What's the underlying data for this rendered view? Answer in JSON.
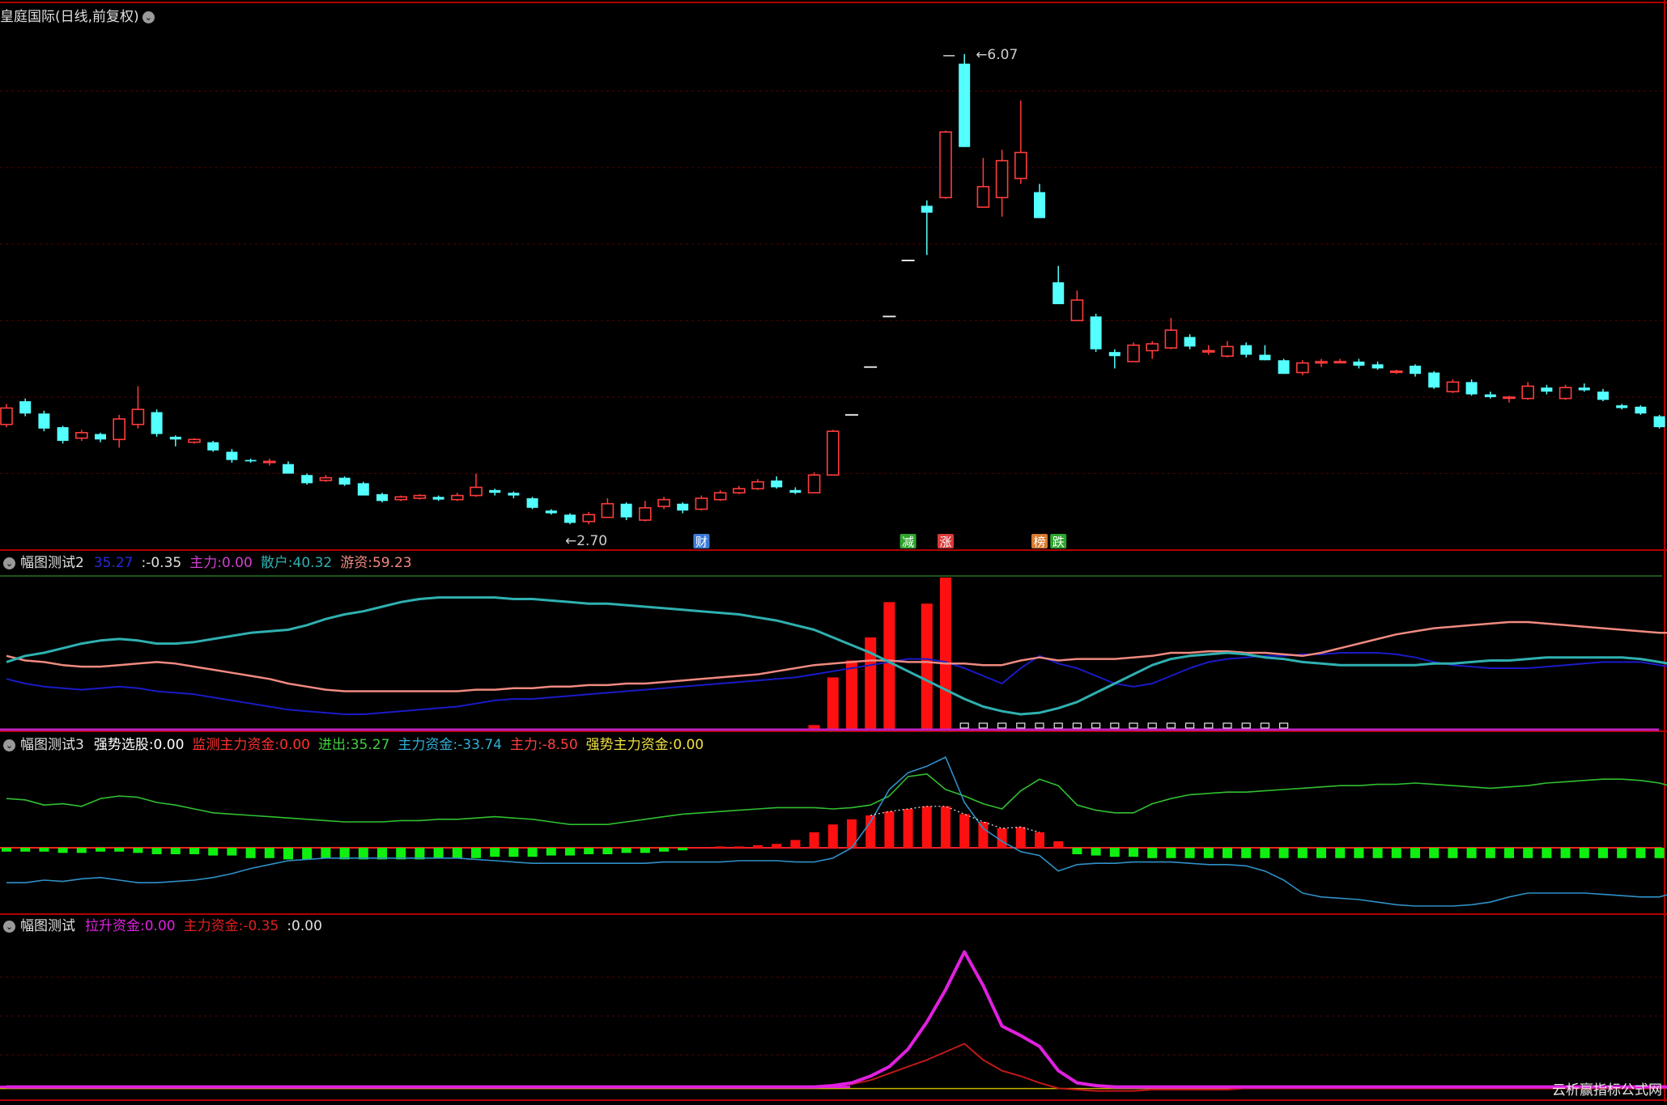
{
  "main": {
    "title": "皇庭国际(日线,前复权)",
    "high_label": "6.07",
    "low_label": "2.70",
    "ylim": [
      2.5,
      6.3
    ],
    "markers": [
      {
        "idx": 37,
        "text": "财",
        "color": "#3d7bd8"
      },
      {
        "idx": 48,
        "text": "减",
        "color": "#2fa52f"
      },
      {
        "idx": 50,
        "text": "涨",
        "color": "#d83a3a"
      },
      {
        "idx": 55,
        "text": "榜",
        "color": "#d87a2f"
      },
      {
        "idx": 56,
        "text": "跌",
        "color": "#2fa52f"
      }
    ]
  },
  "candles": [
    [
      3.36,
      3.48,
      3.51,
      3.34
    ],
    [
      3.53,
      3.44,
      3.55,
      3.42
    ],
    [
      3.44,
      3.33,
      3.46,
      3.31
    ],
    [
      3.34,
      3.24,
      3.35,
      3.22
    ],
    [
      3.26,
      3.3,
      3.32,
      3.24
    ],
    [
      3.29,
      3.25,
      3.3,
      3.23
    ],
    [
      3.25,
      3.4,
      3.43,
      3.19
    ],
    [
      3.36,
      3.47,
      3.64,
      3.33
    ],
    [
      3.45,
      3.29,
      3.47,
      3.27
    ],
    [
      3.27,
      3.25,
      3.28,
      3.2
    ],
    [
      3.23,
      3.25,
      3.26,
      3.22
    ],
    [
      3.23,
      3.17,
      3.24,
      3.16
    ],
    [
      3.16,
      3.1,
      3.18,
      3.08
    ],
    [
      3.1,
      3.09,
      3.11,
      3.08
    ],
    [
      3.09,
      3.09,
      3.11,
      3.06
    ],
    [
      3.07,
      3.0,
      3.09,
      3.0
    ],
    [
      2.99,
      2.93,
      3.0,
      2.92
    ],
    [
      2.95,
      2.97,
      2.99,
      2.94
    ],
    [
      2.97,
      2.92,
      2.98,
      2.91
    ],
    [
      2.93,
      2.84,
      2.94,
      2.84
    ],
    [
      2.85,
      2.8,
      2.86,
      2.79
    ],
    [
      2.81,
      2.83,
      2.84,
      2.8
    ],
    [
      2.82,
      2.84,
      2.85,
      2.81
    ],
    [
      2.83,
      2.81,
      2.84,
      2.8
    ],
    [
      2.81,
      2.84,
      2.86,
      2.8
    ],
    [
      2.84,
      2.9,
      3.0,
      2.83
    ],
    [
      2.88,
      2.86,
      2.89,
      2.84
    ],
    [
      2.86,
      2.84,
      2.87,
      2.82
    ],
    [
      2.82,
      2.75,
      2.83,
      2.74
    ],
    [
      2.73,
      2.71,
      2.74,
      2.7
    ],
    [
      2.7,
      2.64,
      2.71,
      2.63
    ],
    [
      2.65,
      2.7,
      2.72,
      2.63
    ],
    [
      2.68,
      2.78,
      2.82,
      2.68
    ],
    [
      2.78,
      2.68,
      2.79,
      2.66
    ],
    [
      2.66,
      2.75,
      2.8,
      2.65
    ],
    [
      2.76,
      2.81,
      2.83,
      2.74
    ],
    [
      2.78,
      2.73,
      2.79,
      2.71
    ],
    [
      2.74,
      2.82,
      2.84,
      2.73
    ],
    [
      2.81,
      2.86,
      2.88,
      2.8
    ],
    [
      2.86,
      2.89,
      2.91,
      2.85
    ],
    [
      2.89,
      2.94,
      2.96,
      2.88
    ],
    [
      2.95,
      2.9,
      2.98,
      2.89
    ],
    [
      2.88,
      2.86,
      2.9,
      2.85
    ],
    [
      2.86,
      2.99,
      3.01,
      2.86
    ],
    [
      2.99,
      3.31,
      3.32,
      2.99
    ],
    [
      3.43,
      3.43,
      3.43,
      3.43
    ],
    [
      3.78,
      3.78,
      3.78,
      3.78
    ],
    [
      4.15,
      4.15,
      4.15,
      4.15
    ],
    [
      4.56,
      4.56,
      4.56,
      4.56
    ],
    [
      4.96,
      4.91,
      5.0,
      4.6
    ],
    [
      5.02,
      5.5,
      5.51,
      5.01
    ],
    [
      6.0,
      5.39,
      6.07,
      5.39
    ],
    [
      4.95,
      5.1,
      5.31,
      4.95
    ],
    [
      5.02,
      5.29,
      5.37,
      4.88
    ],
    [
      5.16,
      5.35,
      5.73,
      5.12
    ],
    [
      5.06,
      4.87,
      5.12,
      4.87
    ],
    [
      4.4,
      4.24,
      4.52,
      4.24
    ],
    [
      4.12,
      4.27,
      4.34,
      4.12
    ],
    [
      4.15,
      3.91,
      4.17,
      3.89
    ],
    [
      3.89,
      3.86,
      3.91,
      3.77
    ],
    [
      3.82,
      3.94,
      3.96,
      3.82
    ],
    [
      3.9,
      3.95,
      3.97,
      3.84
    ],
    [
      3.92,
      4.05,
      4.14,
      3.91
    ],
    [
      4.0,
      3.93,
      4.02,
      3.91
    ],
    [
      3.89,
      3.9,
      3.94,
      3.87
    ],
    [
      3.86,
      3.93,
      3.97,
      3.85
    ],
    [
      3.94,
      3.87,
      3.96,
      3.85
    ],
    [
      3.87,
      3.83,
      3.94,
      3.83
    ],
    [
      3.83,
      3.73,
      3.84,
      3.73
    ],
    [
      3.74,
      3.81,
      3.83,
      3.72
    ],
    [
      3.81,
      3.82,
      3.84,
      3.78
    ],
    [
      3.82,
      3.82,
      3.84,
      3.81
    ],
    [
      3.82,
      3.79,
      3.84,
      3.77
    ],
    [
      3.8,
      3.77,
      3.82,
      3.76
    ],
    [
      3.75,
      3.75,
      3.76,
      3.73
    ],
    [
      3.79,
      3.73,
      3.8,
      3.71
    ],
    [
      3.74,
      3.63,
      3.75,
      3.62
    ],
    [
      3.6,
      3.67,
      3.69,
      3.59
    ],
    [
      3.67,
      3.58,
      3.69,
      3.57
    ],
    [
      3.58,
      3.56,
      3.6,
      3.55
    ],
    [
      3.56,
      3.56,
      3.57,
      3.52
    ],
    [
      3.55,
      3.64,
      3.67,
      3.54
    ],
    [
      3.63,
      3.6,
      3.65,
      3.58
    ],
    [
      3.55,
      3.63,
      3.65,
      3.54
    ],
    [
      3.63,
      3.61,
      3.66,
      3.6
    ],
    [
      3.6,
      3.54,
      3.62,
      3.53
    ],
    [
      3.5,
      3.48,
      3.51,
      3.47
    ],
    [
      3.49,
      3.44,
      3.5,
      3.43
    ],
    [
      3.42,
      3.34,
      3.43,
      3.33
    ]
  ],
  "ind2": {
    "name": "幅图测试2",
    "items": [
      {
        "label": "",
        "value": "35.27",
        "color": "#2a2ad8"
      },
      {
        "label": "",
        "value": ":-0.35",
        "color": "#e0e0e0"
      },
      {
        "label": "主力:",
        "value": "0.00",
        "color": "#d040d0"
      },
      {
        "label": "散户:",
        "value": "40.32",
        "color": "#30b0b0"
      },
      {
        "label": "游资:",
        "value": "59.23",
        "color": "#f08a80"
      }
    ],
    "ylim": [
      0,
      100
    ],
    "cyan": [
      44,
      48,
      50,
      53,
      56,
      58,
      59,
      58,
      56,
      56,
      57,
      59,
      61,
      63,
      64,
      65,
      68,
      72,
      75,
      77,
      80,
      83,
      85,
      86,
      86,
      86,
      86,
      85,
      85,
      84,
      83,
      82,
      82,
      81,
      80,
      79,
      78,
      77,
      76,
      75,
      73,
      71,
      68,
      65,
      60,
      55,
      50,
      44,
      38,
      32,
      26,
      20,
      15,
      12,
      10,
      11,
      14,
      18,
      24,
      30,
      36,
      42,
      46,
      48,
      49,
      50,
      49,
      47,
      46,
      44,
      43,
      42,
      42,
      42,
      42,
      42,
      43,
      43,
      44,
      45,
      45,
      46,
      47,
      47,
      47,
      47,
      47,
      46,
      44,
      42
    ],
    "pink": [
      48,
      45,
      44,
      42,
      41,
      41,
      42,
      43,
      44,
      43,
      41,
      39,
      37,
      35,
      33,
      30,
      28,
      26,
      25,
      25,
      25,
      25,
      25,
      25,
      25,
      26,
      26,
      27,
      27,
      28,
      28,
      29,
      29,
      30,
      30,
      31,
      32,
      33,
      34,
      35,
      36,
      38,
      40,
      42,
      43,
      44,
      45,
      45,
      44,
      44,
      43,
      43,
      42,
      42,
      45,
      47,
      45,
      46,
      46,
      46,
      47,
      48,
      50,
      50,
      51,
      51,
      50,
      50,
      49,
      48,
      50,
      53,
      56,
      59,
      62,
      64,
      66,
      67,
      68,
      69,
      70,
      70,
      69,
      68,
      67,
      66,
      65,
      64,
      63,
      63
    ],
    "blue": [
      33,
      30,
      28,
      27,
      26,
      27,
      28,
      27,
      25,
      24,
      23,
      21,
      19,
      17,
      15,
      13,
      12,
      11,
      10,
      10,
      11,
      12,
      13,
      14,
      15,
      17,
      19,
      20,
      20,
      21,
      22,
      23,
      24,
      25,
      26,
      27,
      28,
      29,
      30,
      31,
      32,
      33,
      34,
      36,
      38,
      40,
      42,
      44,
      46,
      46,
      44,
      40,
      35,
      30,
      40,
      48,
      43,
      40,
      35,
      30,
      28,
      30,
      35,
      40,
      44,
      46,
      47,
      48,
      48,
      49,
      49,
      50,
      50,
      50,
      49,
      47,
      44,
      42,
      41,
      40,
      40,
      40,
      41,
      42,
      43,
      44,
      44,
      44,
      42,
      40
    ],
    "bars": [
      [
        43,
        3
      ],
      [
        44,
        34
      ],
      [
        45,
        45
      ],
      [
        46,
        60
      ],
      [
        47,
        83
      ],
      [
        49,
        82
      ],
      [
        50,
        99
      ]
    ],
    "squares": [
      51,
      52,
      53,
      54,
      55,
      56,
      57,
      58,
      59,
      60,
      61,
      62,
      63,
      64,
      65,
      66,
      67,
      68
    ]
  },
  "ind3": {
    "name": "幅图测试3",
    "items": [
      {
        "label": "强势选股:",
        "value": "0.00",
        "color": "#ffffff"
      },
      {
        "label": "监测主力资金:",
        "value": "0.00",
        "color": "#ff3030"
      },
      {
        "label": "进出:",
        "value": "35.27",
        "color": "#40d040"
      },
      {
        "label": "主力资金:",
        "value": "-33.74",
        "color": "#30b0d8"
      },
      {
        "label": "主力:",
        "value": "-8.50",
        "color": "#ff4040"
      },
      {
        "label": "强势主力资金:",
        "value": "0.00",
        "color": "#f0e040"
      }
    ],
    "ylim": [
      -50,
      70
    ],
    "green": [
      38,
      37,
      33,
      34,
      32,
      38,
      40,
      39,
      35,
      33,
      30,
      27,
      26,
      25,
      24,
      23,
      22,
      21,
      20,
      20,
      20,
      21,
      21,
      22,
      22,
      23,
      24,
      23,
      22,
      20,
      18,
      18,
      18,
      20,
      22,
      24,
      26,
      27,
      28,
      29,
      30,
      31,
      31,
      31,
      30,
      31,
      33,
      40,
      55,
      57,
      45,
      40,
      34,
      30,
      44,
      53,
      48,
      33,
      29,
      27,
      27,
      34,
      38,
      41,
      42,
      43,
      43,
      44,
      45,
      46,
      47,
      48,
      48,
      49,
      49,
      50,
      49,
      48,
      47,
      46,
      47,
      48,
      50,
      51,
      52,
      53,
      53,
      52,
      50,
      46
    ],
    "blue": [
      -27,
      -27,
      -25,
      -26,
      -24,
      -23,
      -25,
      -27,
      -27,
      -26,
      -25,
      -23,
      -20,
      -16,
      -13,
      -10,
      -9,
      -8,
      -8,
      -8,
      -8,
      -8,
      -8,
      -8,
      -8,
      -9,
      -10,
      -11,
      -12,
      -12,
      -12,
      -12,
      -12,
      -12,
      -12,
      -11,
      -11,
      -11,
      -11,
      -10,
      -10,
      -10,
      -11,
      -11,
      -8,
      0,
      20,
      45,
      58,
      63,
      70,
      35,
      15,
      5,
      -3,
      -6,
      -18,
      -13,
      -12,
      -12,
      -11,
      -11,
      -11,
      -12,
      -13,
      -13,
      -14,
      -18,
      -25,
      -35,
      -38,
      -39,
      -40,
      -42,
      -44,
      -45,
      -45,
      -45,
      -44,
      -42,
      -38,
      -35,
      -35,
      -35,
      -35,
      -36,
      -37,
      -38,
      -38,
      -34
    ],
    "red_bars": [
      [
        38,
        1
      ],
      [
        39,
        1
      ],
      [
        40,
        2
      ],
      [
        41,
        3
      ],
      [
        42,
        6
      ],
      [
        43,
        12
      ],
      [
        44,
        18
      ],
      [
        45,
        22
      ],
      [
        46,
        25
      ],
      [
        47,
        28
      ],
      [
        48,
        30
      ],
      [
        49,
        32
      ],
      [
        50,
        32
      ],
      [
        51,
        26
      ],
      [
        52,
        20
      ],
      [
        53,
        15
      ],
      [
        54,
        16
      ],
      [
        55,
        12
      ],
      [
        56,
        5
      ]
    ],
    "green_bars": [
      0,
      1,
      2,
      3,
      4,
      5,
      6,
      7,
      8,
      9,
      10,
      11,
      12,
      13,
      14,
      15,
      16,
      17,
      18,
      19,
      20,
      21,
      22,
      23,
      24,
      25,
      26,
      27,
      28,
      29,
      30,
      31,
      32,
      33,
      34,
      35,
      36,
      57,
      58,
      59,
      60,
      61,
      62,
      63,
      64,
      65,
      66,
      67,
      68,
      69,
      70,
      71,
      72,
      73,
      74,
      75,
      76,
      77,
      78,
      79,
      80,
      81,
      82,
      83,
      84,
      85,
      86,
      87,
      88,
      89
    ],
    "green_depth": [
      3,
      3,
      3,
      4,
      4,
      3,
      3,
      4,
      5,
      5,
      5,
      6,
      6,
      8,
      8,
      9,
      9,
      8,
      9,
      9,
      9,
      9,
      9,
      8,
      8,
      8,
      7,
      7,
      7,
      6,
      6,
      5,
      5,
      4,
      4,
      3,
      2,
      5,
      6,
      7,
      7,
      8,
      8,
      8,
      8,
      8,
      8,
      8,
      8,
      8,
      8,
      8,
      8,
      8,
      8,
      8,
      8,
      8,
      8,
      8,
      8,
      8,
      8,
      8,
      8,
      8,
      8,
      8,
      8,
      8
    ]
  },
  "ind4": {
    "name": "幅图测试",
    "items": [
      {
        "label": "拉升资金:",
        "value": "0.00",
        "color": "#e020e0"
      },
      {
        "label": "主力资金:",
        "value": "-0.35",
        "color": "#e02020"
      },
      {
        "label": ":",
        "value": "0.00",
        "color": "#e0e0e0"
      }
    ],
    "ylim": [
      -5,
      110
    ],
    "magenta": [
      0,
      0,
      0,
      0,
      0,
      0,
      0,
      0,
      0,
      0,
      0,
      0,
      0,
      0,
      0,
      0,
      0,
      0,
      0,
      0,
      0,
      0,
      0,
      0,
      0,
      0,
      0,
      0,
      0,
      0,
      0,
      0,
      0,
      0,
      0,
      0,
      0,
      0,
      0,
      0,
      0,
      0,
      0,
      0,
      1,
      3,
      8,
      15,
      28,
      48,
      72,
      100,
      75,
      45,
      38,
      30,
      12,
      3,
      1,
      0,
      0,
      0,
      0,
      0,
      0,
      0,
      0,
      0,
      0,
      0,
      0,
      0,
      0,
      0,
      0,
      0,
      0,
      0,
      0,
      0,
      0,
      0,
      0,
      0,
      0,
      0,
      0,
      0,
      0,
      0
    ],
    "darkred": [
      0,
      0,
      0,
      0,
      0,
      0,
      0,
      0,
      0,
      0,
      0,
      0,
      0,
      0,
      0,
      0,
      0,
      0,
      0,
      0,
      0,
      0,
      0,
      0,
      0,
      0,
      0,
      0,
      0,
      0,
      0,
      0,
      0,
      0,
      0,
      0,
      0,
      0,
      0,
      0,
      0,
      0,
      0,
      0,
      1,
      2,
      5,
      10,
      15,
      20,
      26,
      32,
      20,
      12,
      8,
      3,
      -1,
      -2,
      -3,
      -3,
      -3,
      -2,
      -2,
      -2,
      -2,
      -2,
      -1,
      -1,
      -1,
      -1,
      -1,
      -1,
      -1,
      -1,
      -1,
      -1,
      -1,
      -1,
      -1,
      -1,
      -1,
      -1,
      -1,
      -1,
      -1,
      -1,
      -1,
      -1,
      -1,
      -1
    ]
  },
  "watermark": "云析赢指标公式网",
  "colors": {
    "up": "#ff3c3c",
    "down": "#54ffff",
    "grid": "#5a0000",
    "panel_border": "#b00000"
  }
}
